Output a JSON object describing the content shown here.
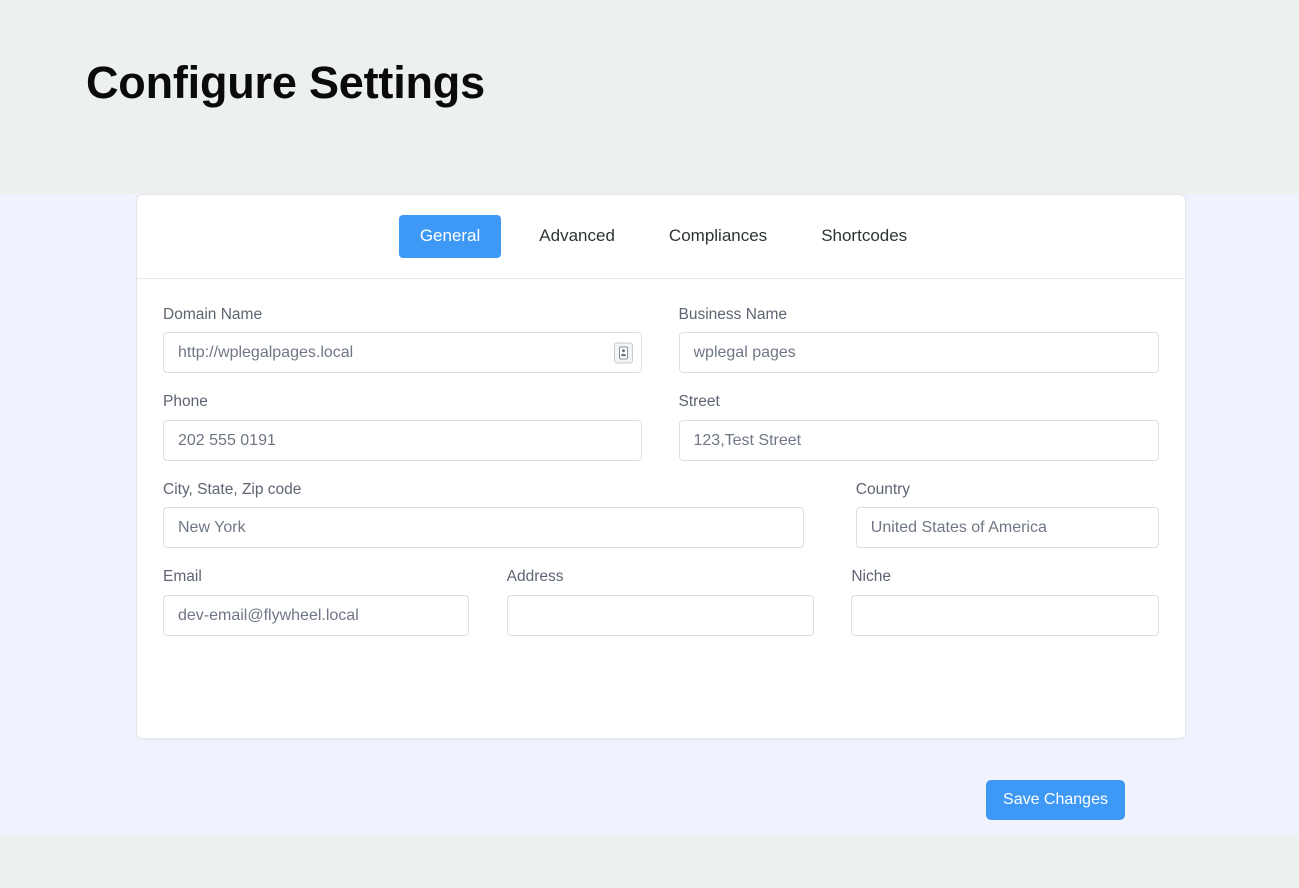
{
  "page": {
    "title": "Configure Settings"
  },
  "theme": {
    "accent": "#3d99f5",
    "header_band": "#ecf1ed",
    "content_band": "#f0f3fd",
    "card_background": "#ffffff",
    "label_color": "#5d6472",
    "input_text_color": "#6f7785",
    "input_border": "#dcdfe6"
  },
  "tabs": [
    {
      "label": "General",
      "active": true
    },
    {
      "label": "Advanced",
      "active": false
    },
    {
      "label": "Compliances",
      "active": false
    },
    {
      "label": "Shortcodes",
      "active": false
    }
  ],
  "form": {
    "fields": {
      "domain_name": {
        "label": "Domain Name",
        "value": "http://wplegalpages.local",
        "placeholder": "",
        "icon": "autofill-contact-card-icon"
      },
      "business_name": {
        "label": "Business Name",
        "value": "wplegal pages",
        "placeholder": ""
      },
      "phone": {
        "label": "Phone",
        "value": "202 555 0191",
        "placeholder": ""
      },
      "street": {
        "label": "Street",
        "value": "123,Test Street",
        "placeholder": ""
      },
      "city_state_zip": {
        "label": "City, State, Zip code",
        "value": "New York",
        "placeholder": ""
      },
      "country": {
        "label": "Country",
        "value": "United States of America",
        "placeholder": ""
      },
      "email": {
        "label": "Email",
        "value": "dev-email@flywheel.local",
        "placeholder": ""
      },
      "address": {
        "label": "Address",
        "value": "",
        "placeholder": ""
      },
      "niche": {
        "label": "Niche",
        "value": "",
        "placeholder": ""
      }
    }
  },
  "actions": {
    "save_label": "Save Changes"
  }
}
